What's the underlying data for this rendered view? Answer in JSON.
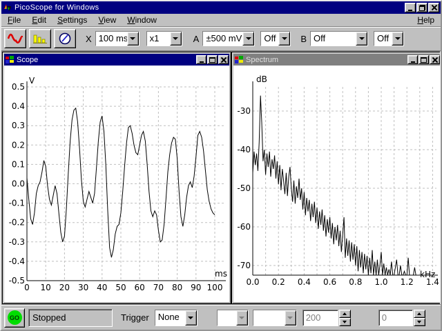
{
  "window": {
    "title": "PicoScope for Windows"
  },
  "menu": {
    "items": [
      "File",
      "Edit",
      "Settings",
      "View",
      "Window"
    ],
    "help": "Help"
  },
  "toolbar": {
    "x_label": "X",
    "timebase": "100 ms",
    "multiplier": "x1",
    "a_label": "A",
    "a_range": "±500 mV",
    "a_mode": "Off",
    "b_label": "B",
    "b_range": "Off",
    "b_mode": "Off"
  },
  "scope_window": {
    "title": "Scope"
  },
  "spectrum_window": {
    "title": "Spectrum"
  },
  "statusbar": {
    "go_label": "GO",
    "status": "Stopped",
    "trigger_label": "Trigger",
    "trigger_mode": "None",
    "channel_field": "",
    "threshold_field": "",
    "samples": "200",
    "offset": "0"
  },
  "colors": {
    "titlebar_active": "#000080",
    "titlebar_inactive": "#808080",
    "face": "#c0c0c0",
    "trace": "#000000",
    "grid": "#bfbfbf",
    "go_green": "#00dd00"
  },
  "chart_data": [
    {
      "type": "line",
      "title": "Scope",
      "xlabel": "ms",
      "ylabel": "V",
      "xlim": [
        0,
        100
      ],
      "ylim": [
        -0.5,
        0.5
      ],
      "grid": true,
      "grid_x_step": 10,
      "xtick_values": [
        0,
        10,
        20,
        30,
        40,
        50,
        60,
        70,
        80,
        90,
        100
      ],
      "xtick_labels": [
        "0",
        "10",
        "20",
        "30",
        "40",
        "50",
        "60",
        "70",
        "80",
        "90",
        "100"
      ],
      "ytick_values": [
        0.5,
        0.4,
        0.3,
        0.2,
        0.1,
        0.0,
        -0.1,
        -0.2,
        -0.3,
        -0.4,
        -0.5
      ],
      "ytick_labels": [
        "0.5",
        "0.4",
        "0.3",
        "0.2",
        "0.1",
        "0.0",
        "-0.1",
        "-0.2",
        "-0.3",
        "-0.4",
        "-0.5"
      ],
      "x_start": 0,
      "x_step": 1,
      "y": [
        0.03,
        -0.08,
        -0.18,
        -0.21,
        -0.15,
        -0.05,
        -0.01,
        0.01,
        0.06,
        0.12,
        0.09,
        -0.01,
        -0.08,
        -0.11,
        -0.06,
        -0.01,
        -0.05,
        -0.15,
        -0.25,
        -0.3,
        -0.27,
        -0.13,
        0.05,
        0.22,
        0.33,
        0.38,
        0.39,
        0.32,
        0.18,
        0.02,
        -0.09,
        -0.12,
        -0.08,
        -0.04,
        -0.07,
        -0.1,
        -0.05,
        0.08,
        0.22,
        0.32,
        0.35,
        0.27,
        0.1,
        -0.14,
        -0.33,
        -0.38,
        -0.34,
        -0.26,
        -0.22,
        -0.21,
        -0.15,
        -0.04,
        0.09,
        0.21,
        0.29,
        0.3,
        0.26,
        0.2,
        0.16,
        0.15,
        0.2,
        0.25,
        0.27,
        0.22,
        0.1,
        -0.04,
        -0.14,
        -0.17,
        -0.14,
        -0.16,
        -0.24,
        -0.3,
        -0.29,
        -0.21,
        -0.08,
        0.06,
        0.15,
        0.21,
        0.24,
        0.23,
        0.13,
        -0.04,
        -0.17,
        -0.22,
        -0.16,
        -0.07,
        -0.01,
        0.01,
        -0.02,
        0.04,
        0.14,
        0.25,
        0.27,
        0.24,
        0.17,
        0.07,
        -0.03,
        -0.09,
        -0.13,
        -0.15,
        -0.16
      ]
    },
    {
      "type": "line",
      "title": "Spectrum",
      "xlabel": "kHz",
      "ylabel": "dB",
      "xlim": [
        0,
        1.5
      ],
      "ylim": [
        -75,
        -25
      ],
      "grid": true,
      "grid_x_step": 0.1,
      "xtick_values": [
        0.0,
        0.2,
        0.4,
        0.6,
        0.8,
        1.0,
        1.2,
        1.4
      ],
      "xtick_labels": [
        "0.0",
        "0.2",
        "0.4",
        "0.6",
        "0.8",
        "1.0",
        "1.2",
        "1.4"
      ],
      "ytick_values": [
        -30,
        -40,
        -50,
        -60,
        -70
      ],
      "ytick_labels": [
        "-30",
        "-40",
        "-50",
        "-60",
        "-70"
      ],
      "x_start": 0,
      "x_step": 0.01,
      "y": [
        -46.0,
        -40.5,
        -44.0,
        -41.0,
        -45.5,
        -38.0,
        -26.0,
        -33.0,
        -43.0,
        -40.0,
        -46.5,
        -41.0,
        -44.5,
        -40.5,
        -47.0,
        -42.5,
        -45.0,
        -41.5,
        -47.5,
        -43.0,
        -49.0,
        -44.0,
        -50.5,
        -45.0,
        -48.0,
        -51.5,
        -46.0,
        -52.0,
        -47.0,
        -44.5,
        -50.0,
        -53.5,
        -48.0,
        -54.0,
        -49.5,
        -52.5,
        -47.5,
        -53.0,
        -50.0,
        -55.5,
        -51.0,
        -57.0,
        -52.5,
        -56.0,
        -53.0,
        -58.5,
        -54.0,
        -57.5,
        -53.5,
        -59.0,
        -55.0,
        -60.5,
        -56.0,
        -59.5,
        -55.5,
        -61.0,
        -57.0,
        -62.5,
        -58.0,
        -61.5,
        -57.5,
        -63.0,
        -59.0,
        -64.5,
        -60.0,
        -63.5,
        -59.5,
        -65.0,
        -61.0,
        -66.5,
        -62.0,
        -57.5,
        -68.0,
        -63.0,
        -67.5,
        -63.5,
        -69.0,
        -64.0,
        -68.5,
        -64.5,
        -70.0,
        -65.0,
        -71.5,
        -66.0,
        -70.5,
        -66.5,
        -72.0,
        -67.0,
        -71.0,
        -67.5,
        -72.5,
        -68.0,
        -72.0,
        -66.0,
        -72.5,
        -69.0,
        -72.5,
        -68.5,
        -72.5,
        -70.0,
        -66.5,
        -72.5,
        -69.5,
        -72.5,
        -70.5,
        -72.5,
        -71.0,
        -72.5,
        -69.0,
        -72.5,
        -72.5,
        -70.5,
        -68.5,
        -72.5,
        -72.5,
        -70.0,
        -72.5,
        -72.5,
        -71.5,
        -72.5,
        -72.5,
        -68.0,
        -72.5,
        -72.5,
        -72.5,
        -72.5,
        -70.5,
        -72.5,
        -72.5,
        -72.5,
        -72.5
      ]
    }
  ]
}
